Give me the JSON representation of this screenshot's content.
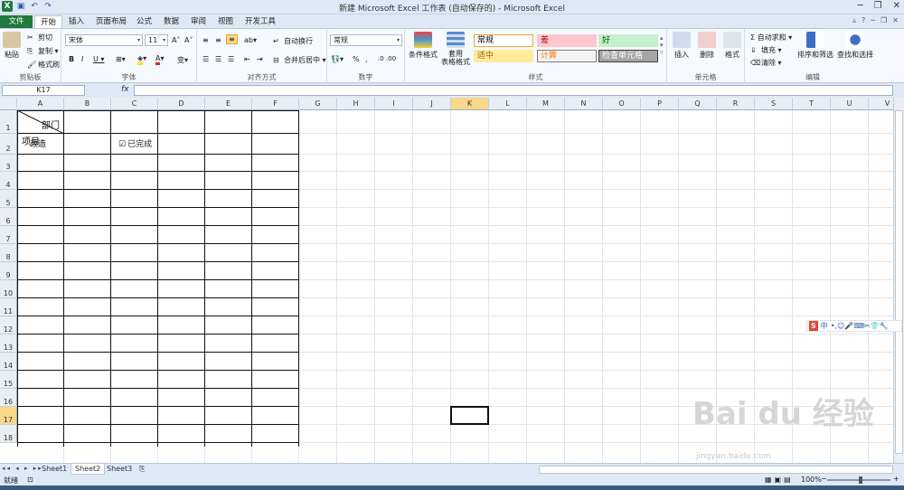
{
  "window": {
    "title": "新建 Microsoft Excel 工作表 (自动保存的) - Microsoft Excel",
    "controls": [
      "─",
      "❐",
      "✕"
    ]
  },
  "qat": {
    "logo": "X",
    "save": "▣",
    "undo": "↶",
    "redo": "↷"
  },
  "tabs": [
    "文件",
    "开始",
    "插入",
    "页面布局",
    "公式",
    "数据",
    "审阅",
    "视图",
    "开发工具"
  ],
  "ribbon": {
    "clipboard": {
      "label": "剪贴板",
      "paste": "粘贴",
      "cut": "剪切",
      "copy": "复制 ▾",
      "format_painter": "格式刷"
    },
    "font": {
      "label": "字体",
      "name": "宋体",
      "size": "11",
      "grow": "A˄",
      "shrink": "A˅",
      "bold": "B",
      "italic": "I",
      "underline": "U ▾",
      "phonetic": "变▾"
    },
    "alignment": {
      "label": "对齐方式",
      "wrap": "自动换行",
      "merge": "合并后居中 ▾"
    },
    "number": {
      "label": "数字",
      "format": "常规",
      "percent": "%",
      "comma": ",",
      "inc_dec": ".0 .00"
    },
    "styles": {
      "label": "样式",
      "conditional": "条件格式",
      "table": "套用\n表格格式",
      "cells": [
        {
          "text": "常规",
          "bg": "#ffffff",
          "color": "#000000",
          "border": "#f0a830"
        },
        {
          "text": "差",
          "bg": "#ffc7ce",
          "color": "#9c0006",
          "border": "#ffc7ce"
        },
        {
          "text": "好",
          "bg": "#c6efce",
          "color": "#006100",
          "border": "#c6efce"
        },
        {
          "text": "适中",
          "bg": "#ffeb9c",
          "color": "#9c6500",
          "border": "#ffeb9c"
        },
        {
          "text": "计算",
          "bg": "#f2f2f2",
          "color": "#fa7d00",
          "border": "#7f7f7f"
        },
        {
          "text": "检查单元格",
          "bg": "#a5a5a5",
          "color": "#ffffff",
          "border": "#3f3f3f"
        }
      ]
    },
    "cells": {
      "label": "单元格",
      "insert": "插入",
      "delete": "删除",
      "format": "格式"
    },
    "editing": {
      "label": "编辑",
      "autosum": "Σ 自动求和 ▾",
      "fill": "填充 ▾",
      "clear": "清除 ▾",
      "sort": "排序和筛选",
      "find": "查找和选择"
    }
  },
  "formula_bar": {
    "name_box": "K17",
    "fx": "fx",
    "value": ""
  },
  "columns": [
    "A",
    "B",
    "C",
    "D",
    "E",
    "F",
    "G",
    "H",
    "I",
    "J",
    "K",
    "L",
    "M",
    "N",
    "O",
    "P",
    "Q",
    "R",
    "S",
    "T",
    "U",
    "V"
  ],
  "rows": [
    "1",
    "2",
    "3",
    "4",
    "5",
    "6",
    "7",
    "8",
    "9",
    "10",
    "11",
    "12",
    "13",
    "14",
    "15",
    "16",
    "17",
    "18"
  ],
  "cells": {
    "a1_top": "部门",
    "a1_bottom": "项目",
    "a2": "改造",
    "c2_checkbox": "已完成"
  },
  "selection": {
    "col": "K",
    "row": "17"
  },
  "sheets": [
    "Sheet1",
    "Sheet2",
    "Sheet3"
  ],
  "active_sheet": "Sheet2",
  "status": {
    "ready": "就绪",
    "zoom": "100%",
    "zoom_minus": "−",
    "zoom_plus": "+"
  },
  "ime": {
    "brand": "S",
    "lang": "中",
    "icons": "•,☺🎤⌨✂👕🔧"
  },
  "watermark": {
    "logo": "Bai du 经验",
    "url": "jingyan.baidu.com"
  }
}
